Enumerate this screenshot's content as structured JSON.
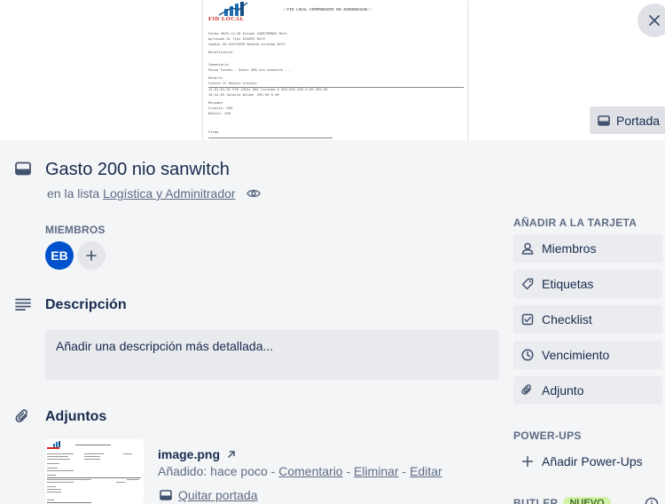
{
  "cover": {
    "document": {
      "logo_text": "FID LOCAL",
      "title": "::FID LOCAL COMPROBANTE NO:JE000003286::",
      "lines": [
        "Fecha      2020-12-28          Estado    CONFIRMADO          Ref1",
        "Aplicado   Si                  Tipo      DIARIO              Ref2",
        "Cambio     36.51072000         Moneda    Cordoba             Ref3",
        "Beneficiario",
        "Comentario",
        "Pausa fondos - Gasto 200 nio sanwitch ....",
        "Detalle",
        "Cuenta                                     CC               Debito        Credito",
        "11-01-01-01 FID LOCAL BAC Cordoba # 363-555-333                  0.00         200.00",
        "16-54-05 Salario Wilmer                                        200.00           0.00",
        "Resumen",
        "Credito:    200",
        "Debito:     200",
        "Firma"
      ]
    },
    "button_label": "Portada"
  },
  "card": {
    "title": "Gasto 200 nio sanwitch",
    "list_prefix": "en la lista",
    "list_name": "Logística y Adminitrador"
  },
  "members": {
    "heading": "MIEMBROS",
    "avatar_initials": "EB"
  },
  "description": {
    "title": "Descripción",
    "placeholder": "Añadir una descripción más detallada..."
  },
  "attachments": {
    "title": "Adjuntos",
    "file_name": "image.png",
    "added_prefix": "Añadido: hace poco - ",
    "comment_link": "Comentario",
    "separator": " - ",
    "delete_link": "Eliminar",
    "edit_link": "Editar",
    "remove_cover": "Quitar portada"
  },
  "sidebar": {
    "add_heading": "AÑADIR A LA TARJETA",
    "buttons": [
      {
        "label": "Miembros",
        "icon": "person-icon"
      },
      {
        "label": "Etiquetas",
        "icon": "tag-icon"
      },
      {
        "label": "Checklist",
        "icon": "checkbox-icon"
      },
      {
        "label": "Vencimiento",
        "icon": "clock-icon"
      },
      {
        "label": "Adjunto",
        "icon": "paperclip-icon"
      }
    ],
    "powerups_heading": "POWER-UPS",
    "add_powerups": "Añadir Power-Ups",
    "butler_label": "BUTLER",
    "butler_badge": "NUEVO"
  },
  "colors": {
    "avatar": "#0052cc",
    "background": "#f4f5f7",
    "button": "#ebecf0",
    "badge": "#d3f1a7"
  }
}
